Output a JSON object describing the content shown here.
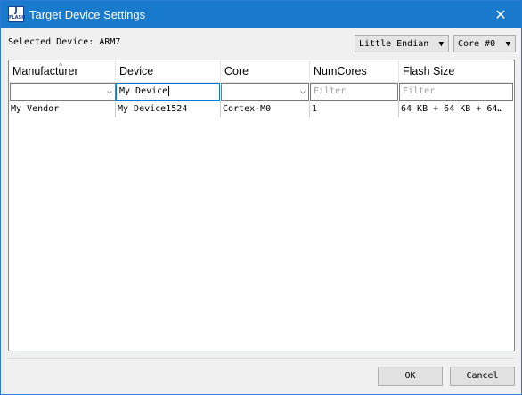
{
  "window": {
    "title": "Target Device Settings",
    "app_icon_text_top": "J",
    "app_icon_text_bottom": "FLASH",
    "close_glyph": "✕"
  },
  "selected_device": "Selected Device: ARM7",
  "endian_select": {
    "value": "Little Endian",
    "arrow": "▼"
  },
  "core_select": {
    "value": "Core #0",
    "arrow": "▼"
  },
  "table": {
    "columns": [
      "Manufacturer",
      "Device",
      "Core",
      "NumCores",
      "Flash Size"
    ],
    "sort_indicator": "^",
    "filters": {
      "manufacturer_value": "",
      "device_value": "My Device",
      "core_value": "",
      "numcores_placeholder": "Filter",
      "flash_placeholder": "Filter",
      "dropdown_glyph": "⌵"
    },
    "rows": [
      [
        "My Vendor",
        "My Device1524",
        "Cortex-M0",
        "1",
        "64 KB + 64 KB + 64…"
      ]
    ]
  },
  "buttons": {
    "ok": "OK",
    "cancel": "Cancel"
  }
}
